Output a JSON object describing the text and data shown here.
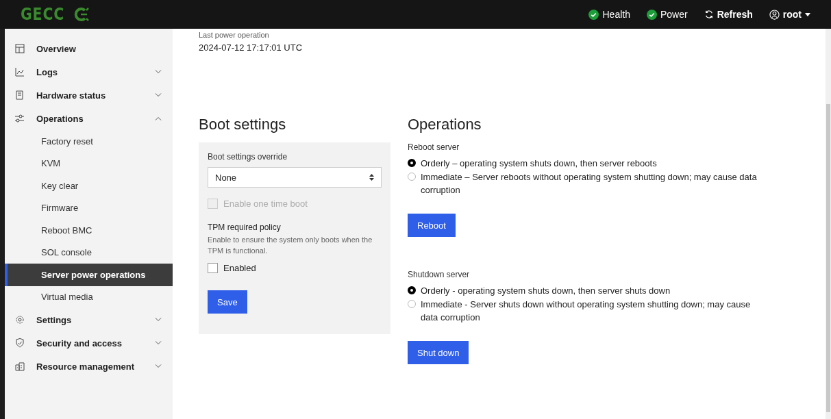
{
  "header": {
    "logo": "GECC",
    "status": [
      {
        "label": "Health",
        "ok": true
      },
      {
        "label": "Power",
        "ok": true
      }
    ],
    "refresh": "Refresh",
    "user": "root"
  },
  "sidebar": {
    "items": [
      {
        "label": "Overview",
        "kind": "link"
      },
      {
        "label": "Logs",
        "kind": "group",
        "expanded": false
      },
      {
        "label": "Hardware status",
        "kind": "group",
        "expanded": false
      },
      {
        "label": "Operations",
        "kind": "group",
        "expanded": true,
        "children": [
          {
            "label": "Factory reset",
            "selected": false
          },
          {
            "label": "KVM",
            "selected": false
          },
          {
            "label": "Key clear",
            "selected": false
          },
          {
            "label": "Firmware",
            "selected": false
          },
          {
            "label": "Reboot BMC",
            "selected": false
          },
          {
            "label": "SOL console",
            "selected": false
          },
          {
            "label": "Server power operations",
            "selected": true
          },
          {
            "label": "Virtual media",
            "selected": false
          }
        ]
      },
      {
        "label": "Settings",
        "kind": "group",
        "expanded": false
      },
      {
        "label": "Security and access",
        "kind": "group",
        "expanded": false
      },
      {
        "label": "Resource management",
        "kind": "group",
        "expanded": false
      }
    ]
  },
  "last_power": {
    "label": "Last power operation",
    "value": "2024-07-12 17:17:01 UTC"
  },
  "boot": {
    "title": "Boot settings",
    "override_label": "Boot settings override",
    "override_value": "None",
    "one_time": {
      "label": "Enable one time boot",
      "checked": false,
      "disabled": true
    },
    "tpm_title": "TPM required policy",
    "tpm_help": "Enable to ensure the system only boots when the TPM is functional.",
    "tpm": {
      "label": "Enabled",
      "checked": false,
      "disabled": false
    },
    "save": "Save"
  },
  "operations": {
    "title": "Operations",
    "sections": [
      {
        "label": "Reboot server",
        "options": [
          {
            "label": "Orderly – operating system shuts down, then server reboots",
            "selected": true
          },
          {
            "label": "Immediate – Server reboots without operating system shutting down; may cause data corruption",
            "selected": false
          }
        ],
        "button": "Reboot"
      },
      {
        "label": "Shutdown server",
        "options": [
          {
            "label": "Orderly - operating system shuts down, then server shuts down",
            "selected": true
          },
          {
            "label": "Immediate - Server shuts down without operating system shutting down; may cause data corruption",
            "selected": false
          }
        ],
        "button": "Shut down"
      }
    ]
  }
}
